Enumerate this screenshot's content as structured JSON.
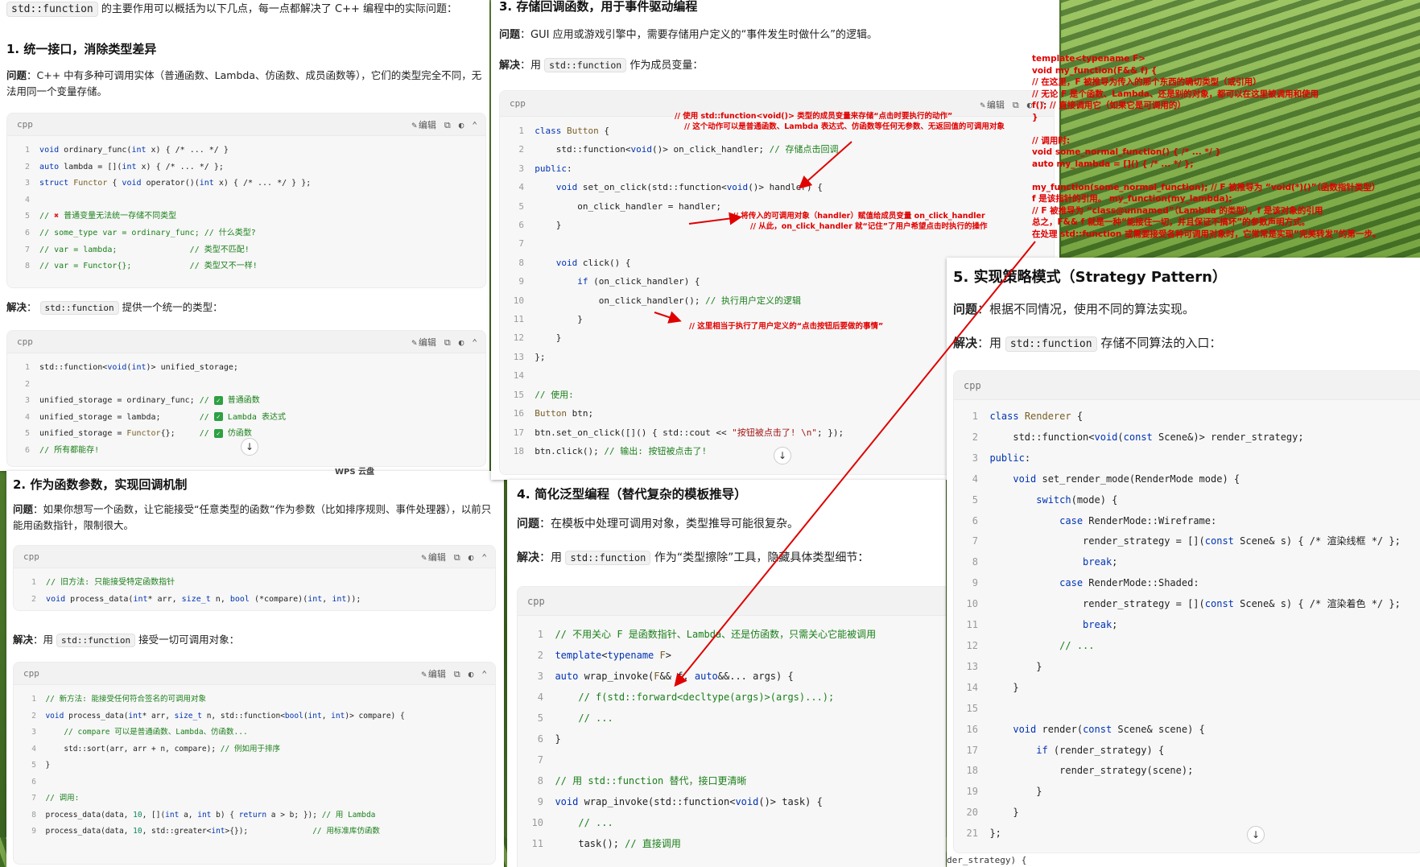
{
  "colors": {
    "annotation": "#e00000",
    "accent_green": "#2ea043",
    "keyword": "#0033b3",
    "comment": "#1a7f1a"
  },
  "common": {
    "lang": "cpp",
    "edit": "编辑",
    "problem": "问题",
    "solution": "解决"
  },
  "panel1": {
    "intro_code": "std::function",
    "intro_text": "的主要作用可以概括为以下几点，每一点都解决了 C++ 编程中的实际问题：",
    "heading": "1. 统一接口，消除类型差异",
    "problem_text": "：C++ 中有多种可调用实体（普通函数、Lambda、仿函数、成员函数等），它们的类型完全不同，无法用同一个变量存储。",
    "code1": [
      "void ordinary_func(int x) { /* ... */ }",
      "auto lambda = [](int x) { /* ... */ };",
      "struct Functor { void operator()(int x) { /* ... */ } };",
      "",
      "// ❌ 普通变量无法统一存储不同类型",
      "// some_type var = ordinary_func; // 什么类型?",
      "// var = lambda;               // 类型不匹配!",
      "// var = Functor{};            // 类型又不一样!"
    ],
    "solution_pre": "：",
    "solution_code": "std::function",
    "solution_text": "提供一个统一的类型：",
    "code2": [
      "std::function<void(int)> unified_storage;",
      "",
      "unified_storage = ordinary_func; // ✅ 普通函数",
      "unified_storage = lambda;        // ✅ Lambda 表达式",
      "unified_storage = Functor{};     // ✅ 仿函数",
      "// 所有都能存!"
    ]
  },
  "panel2": {
    "heading": "2. 作为函数参数，实现回调机制",
    "problem_text": "：如果你想写一个函数，让它能接受“任意类型的函数”作为参数（比如排序规则、事件处理器），以前只能用函数指针，限制很大。",
    "code1": [
      "// 旧方法: 只能接受特定函数指针",
      "void process_data(int* arr, size_t n, bool (*compare)(int, int));"
    ],
    "solution_pre": "：用",
    "solution_code": "std::function",
    "solution_text": "接受一切可调用对象：",
    "code2": [
      "// 新方法: 能接受任何符合签名的可调用对象",
      "void process_data(int* arr, size_t n, std::function<bool(int, int)> compare) {",
      "    // compare 可以是普通函数、Lambda、仿函数...",
      "    std::sort(arr, arr + n, compare); // 例如用于排序",
      "}",
      "",
      "// 调用:",
      "process_data(data, 10, [](int a, int b) { return a > b; }); // 用 Lambda",
      "process_data(data, 10, std::greater<int>{});              // 用标准库仿函数"
    ]
  },
  "panel3": {
    "heading": "3. 存储回调函数，用于事件驱动编程",
    "problem_text": "：GUI 应用或游戏引擎中，需要存储用户定义的“事件发生时做什么”的逻辑。",
    "solution_pre": "：用",
    "solution_code": "std::function",
    "solution_text": "作为成员变量：",
    "code": [
      "class Button {",
      "    std::function<void()> on_click_handler; // 存储点击回调",
      "public:",
      "    void set_on_click(std::function<void()> handler) {",
      "        on_click_handler = handler;",
      "    }",
      "",
      "    void click() {",
      "        if (on_click_handler) {",
      "            on_click_handler(); // 执行用户定义的逻辑",
      "        }",
      "    }",
      "};",
      "",
      "// 使用:",
      "Button btn;",
      "btn.set_on_click([]() { std::cout << \"按钮被点击了! \\n\"; });",
      "btn.click(); // 输出: 按钮被点击了!"
    ]
  },
  "panel4": {
    "heading": "4. 简化泛型编程（替代复杂的模板推导）",
    "problem_text": "：在模板中处理可调用对象，类型推导可能很复杂。",
    "solution_pre": "：用",
    "solution_code": "std::function",
    "solution_text": "作为“类型擦除”工具，隐藏具体类型细节：",
    "code": [
      "// 不用关心 F 是函数指针、Lambda、还是仿函数，只需关心它能被调用",
      "template<typename F>",
      "auto wrap_invoke(F&& f, auto&&... args) {",
      "    // f(std::forward<decltype(args)>(args)...);",
      "    // ...",
      "}",
      "",
      "// 用 std::function 替代，接口更清晰",
      "void wrap_invoke(std::function<void()> task) {",
      "    // ...",
      "    task(); // 直接调用"
    ]
  },
  "panel5": {
    "heading": "5. 实现策略模式（Strategy Pattern）",
    "problem_text": "：根据不同情况，使用不同的算法实现。",
    "solution_pre": "：用",
    "solution_code": "std::function",
    "solution_text": "存储不同算法的入口：",
    "code": [
      "class Renderer {",
      "    std::function<void(const Scene&)> render_strategy;",
      "public:",
      "    void set_render_mode(RenderMode mode) {",
      "        switch(mode) {",
      "            case RenderMode::Wireframe:",
      "                render_strategy = [](const Scene& s) { /* 渲染线框 */ };",
      "                break;",
      "            case RenderMode::Shaded:",
      "                render_strategy = [](const Scene& s) { /* 渲染着色 */ };",
      "                break;",
      "            // ...",
      "        }",
      "    }",
      "",
      "    void render(const Scene& scene) {",
      "        if (render_strategy) {",
      "            render_strategy(scene);",
      "        }",
      "    }",
      "};"
    ],
    "below_text": "der_strategy) {"
  },
  "annotations": {
    "a1": "// 使用 std::function<void()> 类型的成员变量来存储“点击时要执行的动作”",
    "a2": "// 这个动作可以是普通函数、Lambda 表达式、仿函数等任何无参数、无返回值的可调用对象",
    "a3": "// 将传入的可调用对象（handler）赋值给成员变量 on_click_handler",
    "a4": "// 从此，on_click_handler 就“记住”了用户希望点击时执行的操作",
    "a5": "// 这里相当于执行了用户定义的“点击按钮后要做的事情”",
    "top_right": [
      "template<typename F>",
      "void my_function(F&& f) {",
      "    // 在这里，F 被推导为传入的那个东西的确切类型（或引用）",
      "    // 无论 F 是个函数、Lambda、还是别的对象，都可以在这里被调用和使用",
      "    f(); // 直接调用它（如果它是可调用的）",
      "}",
      "",
      "// 调用时:",
      "void some_normal_function() { /* ... */ }",
      "auto my_lambda = []() { /* ... */ };",
      "",
      "my_function(some_normal_function); // F 被推导为 “void(*)()”（函数指针类型）",
      "f 是该指针的引用。 my_function(my_lambda);",
      "  // F 被推导为 “class@unnamed”（Lambda 的类型），f 是该对象的引用",
      "总之，F&& f 就是一种“能接住一切，并且保证不搞坏”的参数声明方式。",
      "在处理 std::function 或需要接受各种可调用对象时，它常常是实现“完美转发”的第一步。"
    ]
  },
  "bottom_fragment": "WPS 云盘"
}
